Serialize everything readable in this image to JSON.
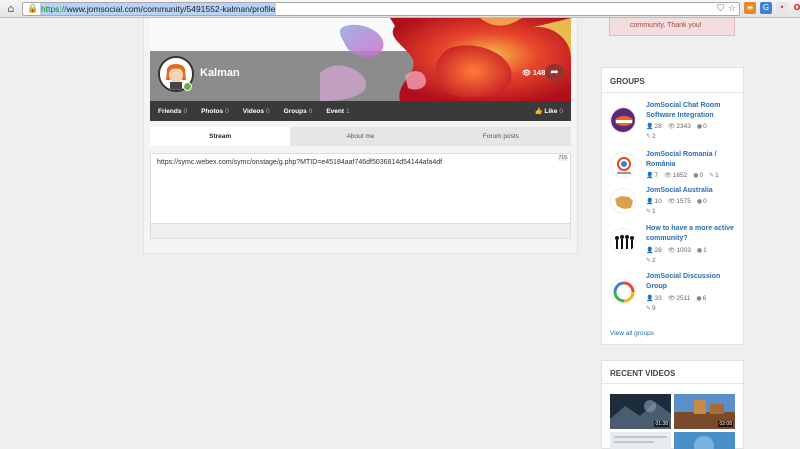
{
  "browser": {
    "url_scheme": "https://",
    "url_rest": "www.jomsocial.com/community/5491552-kalman/profile"
  },
  "notice": {
    "text": "community. Thank you!"
  },
  "profile": {
    "name": "Kalman",
    "views": "148",
    "menu": [
      {
        "label": "Friends",
        "count": "0"
      },
      {
        "label": "Photos",
        "count": "0"
      },
      {
        "label": "Videos",
        "count": "0"
      },
      {
        "label": "Groups",
        "count": "0"
      },
      {
        "label": "Event",
        "count": "1"
      }
    ],
    "like": {
      "label": "Like",
      "count": "0"
    }
  },
  "tabs": [
    "Stream",
    "About me",
    "Forum posts"
  ],
  "composer": {
    "text": "https://symc.webex.com/symc/onstage/g.php?MTID=e45184aaf746df5036814d54144afa4df",
    "char_count": "715"
  },
  "groups": {
    "title": "GROUPS",
    "items": [
      {
        "name": "JomSocial Chat Room Software Integration",
        "members": "28",
        "views": "2343",
        "comments": "0",
        "edits": "2"
      },
      {
        "name": "JomSocial Romania / România",
        "members": "7",
        "views": "1652",
        "comments": "0",
        "edits": "1"
      },
      {
        "name": "JomSocial Australia",
        "members": "10",
        "views": "1575",
        "comments": "0",
        "edits": "1"
      },
      {
        "name": "How to have a more active community?",
        "members": "28",
        "views": "1003",
        "comments": "1",
        "edits": "2"
      },
      {
        "name": "JomSocial Discussion Group",
        "members": "33",
        "views": "2511",
        "comments": "6",
        "edits": "9"
      }
    ],
    "view_all": "View all groups"
  },
  "videos": {
    "title": "RECENT VIDEOS",
    "items": [
      {
        "duration": "01:38"
      },
      {
        "duration": "02:08"
      }
    ]
  },
  "colors": {
    "link": "#2a6db5",
    "menubar": "#3a3a3a",
    "share": "#9b3030",
    "online": "#6ab04c"
  }
}
